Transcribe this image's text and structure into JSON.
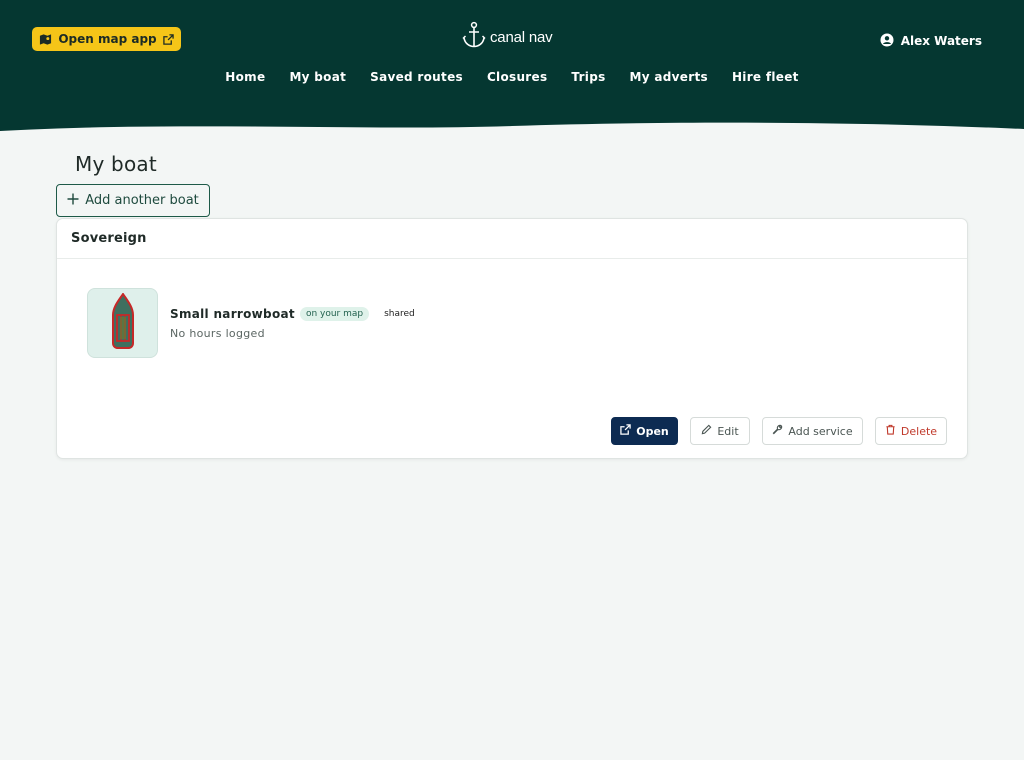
{
  "header": {
    "map_app_label": "Open map app",
    "logo_text": "canal nav",
    "user_name": "Alex Waters",
    "nav": [
      "Home",
      "My boat",
      "Saved routes",
      "Closures",
      "Trips",
      "My adverts",
      "Hire fleet"
    ]
  },
  "page": {
    "title": "My boat",
    "add_button_label": "Add another boat"
  },
  "boat_card": {
    "boat_name": "Sovereign",
    "boat_type": "Small narrowboat",
    "map_badge": "on your map",
    "shared_label": "shared",
    "hours": "No hours logged",
    "actions": {
      "open": "Open",
      "edit": "Edit",
      "service": "Add service",
      "delete": "Delete"
    }
  },
  "colors": {
    "header_bg": "#053731",
    "accent_yellow": "#f5c518",
    "open_button": "#0d2b52",
    "delete_red": "#c0392b",
    "boat_hull": "#3f6f5f",
    "boat_outline": "#c62828"
  },
  "icons": [
    "map-icon",
    "external-link-icon",
    "anchor-icon",
    "user-circle-icon",
    "plus-icon",
    "narrowboat-icon",
    "pencil-icon",
    "wrench-icon",
    "trash-icon"
  ]
}
